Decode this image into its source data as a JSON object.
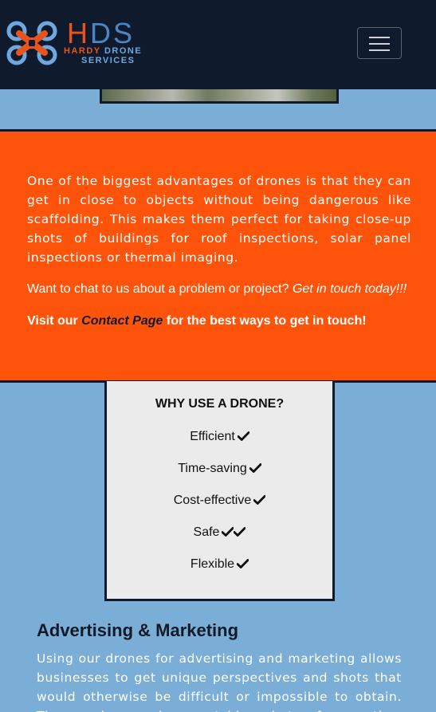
{
  "navbar": {
    "logo_letters_h": "H",
    "logo_letters_ds": "DS",
    "logo_line1_a": "HARDY",
    "logo_line1_b": "DRONE",
    "logo_line2": "SERVICES",
    "toggle_icon": "hamburger-icon",
    "colors": {
      "background": "#0f1b2d",
      "brand_orange": "#e8541c",
      "brand_blue": "#4b86c2"
    }
  },
  "intro": {
    "paragraph": "One of the biggest advantages of drones is that they can get in close to objects without being dangerous like scaffolding. This makes them perfect for taking close-up shots of buildings for roof inspections, solar panel inspections or thermal imaging.",
    "chat_text": "Want to chat to us about a problem or project?",
    "chat_cta": "Get in touch today!!!",
    "visit_prefix": "Visit our",
    "contact_link": "Contact Page",
    "visit_suffix": "for the best ways to get in touch!",
    "background_color": "#fd530a"
  },
  "why_drone": {
    "title": "WHY USE A DRONE?",
    "items": [
      {
        "label": "Efficient",
        "checks": 1
      },
      {
        "label": "Time-saving",
        "checks": 1
      },
      {
        "label": "Cost-effective",
        "checks": 1
      },
      {
        "label": "Safe",
        "checks": 2
      },
      {
        "label": "Flexible",
        "checks": 1
      }
    ],
    "icon": "checkmark-icon"
  },
  "advertising": {
    "title": "Advertising & Marketing",
    "paragraph": "Using our drones for advertising and marketing allows businesses to get unique perspectives and shots that would otherwise be difficult or impossible to obtain. These unique and eye-catching shots of properties, locations"
  },
  "page": {
    "background_color": "#7aaed6"
  }
}
